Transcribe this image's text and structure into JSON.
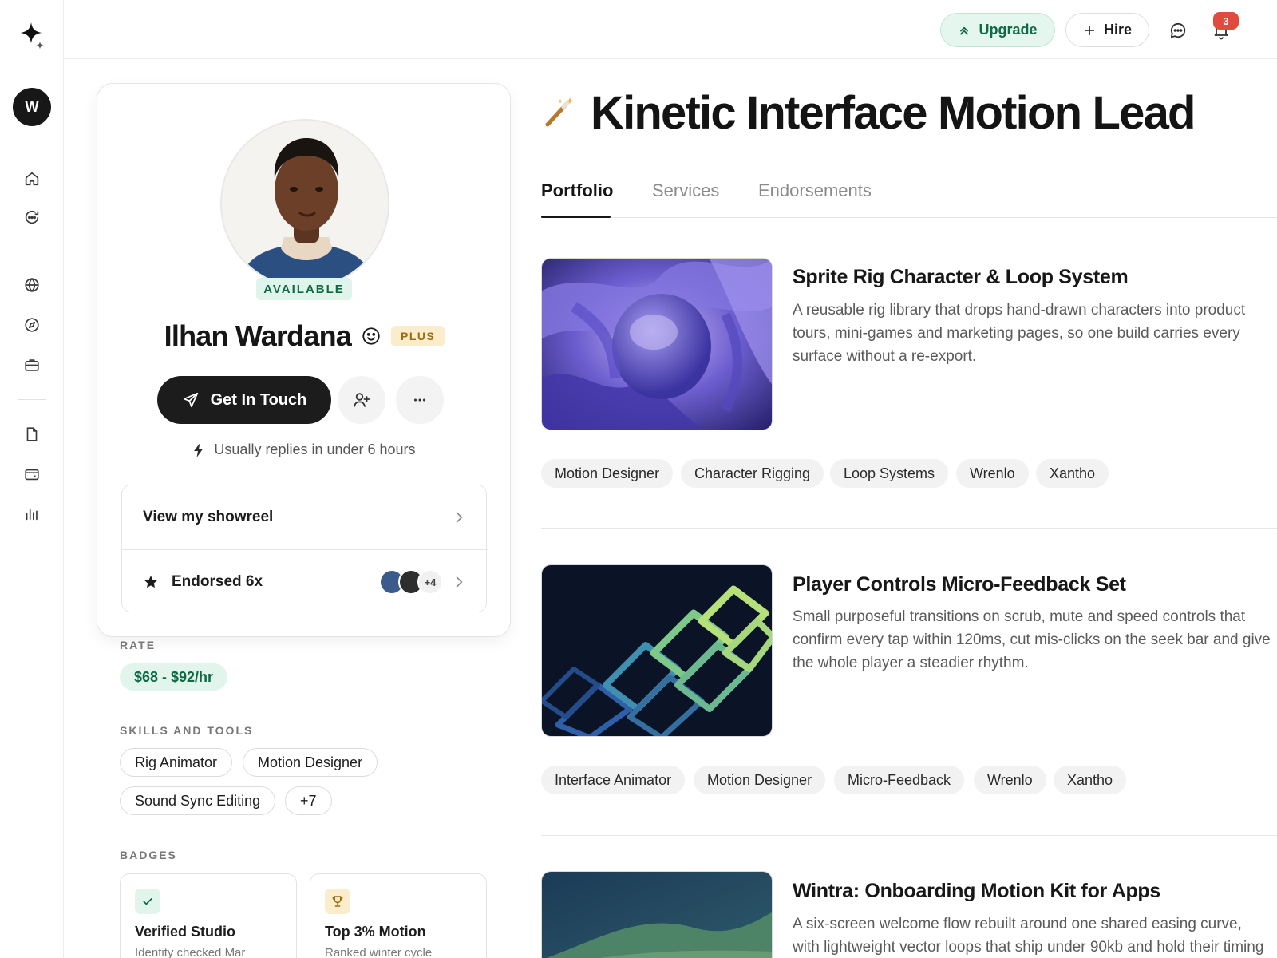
{
  "topbar": {
    "upgrade_label": "Upgrade",
    "hire_label": "Hire",
    "notification_count": "3"
  },
  "rail": {
    "workspace_initial": "W"
  },
  "profile": {
    "availability": "AVAILABLE",
    "name": "Ilhan Wardana",
    "tier_badge": "PLUS",
    "contact_label": "Get In Touch",
    "reply_time": "Usually replies in under 6 hours",
    "showreel_label": "View my showreel",
    "endorsed_label": "Endorsed 6x",
    "endorsers_more": "+4"
  },
  "rate": {
    "label": "RATE",
    "value": "$68 - $92/hr"
  },
  "skills": {
    "label": "SKILLS AND TOOLS",
    "items": [
      "Rig Animator",
      "Motion Designer",
      "Sound Sync Editing",
      "+7"
    ]
  },
  "badges": {
    "label": "BADGES",
    "items": [
      {
        "title": "Verified Studio",
        "subtitle": "Identity checked Mar"
      },
      {
        "title": "Top 3% Motion",
        "subtitle": "Ranked winter cycle"
      }
    ]
  },
  "main": {
    "title": "Kinetic Interface Motion Lead",
    "tabs": [
      "Portfolio",
      "Services",
      "Endorsements"
    ],
    "projects": [
      {
        "title": "Sprite Rig Character & Loop System",
        "description": "A reusable rig library that drops hand-drawn characters into product tours, mini-games and marketing pages, so one build carries every surface without a re-export.",
        "tags": [
          "Motion Designer",
          "Character Rigging",
          "Loop Systems",
          "Wrenlo",
          "Xantho"
        ]
      },
      {
        "title": "Player Controls Micro-Feedback Set",
        "description": "Small purposeful transitions on scrub, mute and speed controls that confirm every tap within 120ms, cut mis-clicks on the seek bar and give the whole player a steadier rhythm.",
        "tags": [
          "Interface Animator",
          "Motion Designer",
          "Micro-Feedback",
          "Wrenlo",
          "Xantho"
        ]
      },
      {
        "title": "Wintra: Onboarding Motion Kit for Apps",
        "description": "A six-screen welcome flow rebuilt around one shared easing curve, with lightweight vector loops that ship under 90kb and hold their timing on",
        "tags": []
      }
    ]
  },
  "colors": {
    "accent_green": "#0d6b47",
    "green_bg": "#e4f6ee",
    "notification_red": "#df4b3c",
    "plus_gold": "#9b6a12",
    "dark": "#1c1c1c"
  }
}
